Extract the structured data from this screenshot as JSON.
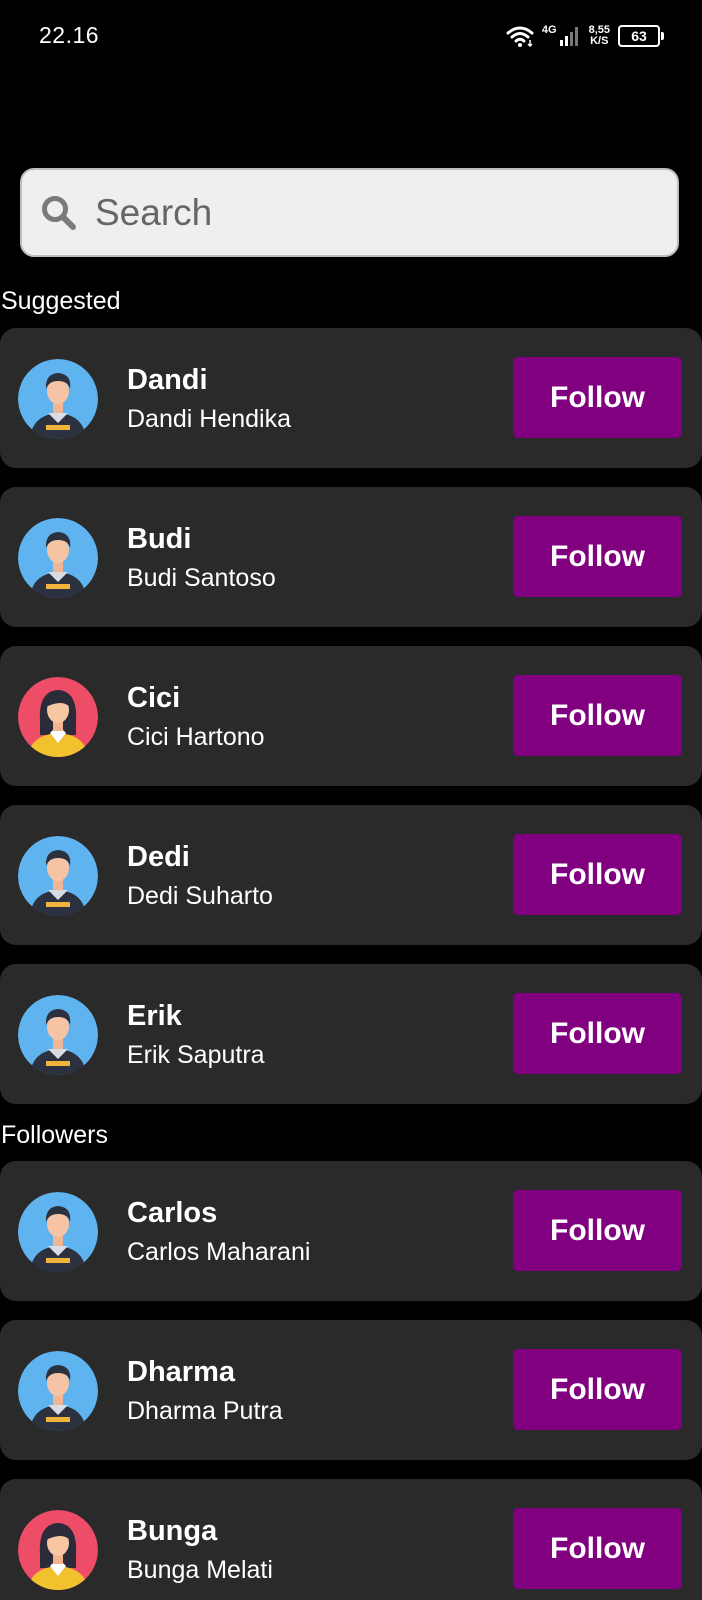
{
  "status_bar": {
    "time": "22.16",
    "network_type": "4G",
    "speed_value": "8,55",
    "speed_unit": "K/S",
    "battery": "63"
  },
  "search": {
    "placeholder": "Search"
  },
  "sections": {
    "suggested": {
      "heading": "Suggested",
      "users": [
        {
          "username": "Dandi",
          "fullname": "Dandi Hendika",
          "button": "Follow",
          "avatar": "male"
        },
        {
          "username": "Budi",
          "fullname": "Budi Santoso",
          "button": "Follow",
          "avatar": "male"
        },
        {
          "username": "Cici",
          "fullname": "Cici Hartono",
          "button": "Follow",
          "avatar": "female"
        },
        {
          "username": "Dedi",
          "fullname": "Dedi Suharto",
          "button": "Follow",
          "avatar": "male"
        },
        {
          "username": "Erik",
          "fullname": "Erik Saputra",
          "button": "Follow",
          "avatar": "male"
        }
      ]
    },
    "followers": {
      "heading": "Followers",
      "users": [
        {
          "username": "Carlos",
          "fullname": "Carlos Maharani",
          "button": "Follow",
          "avatar": "male"
        },
        {
          "username": "Dharma",
          "fullname": "Dharma Putra",
          "button": "Follow",
          "avatar": "male"
        },
        {
          "username": "Bunga",
          "fullname": "Bunga Melati",
          "button": "Follow",
          "avatar": "female"
        }
      ]
    }
  },
  "colors": {
    "background": "#000000",
    "card": "#2a2a2b",
    "follow_button": "#800080",
    "male_avatar_bg": "#5fb4f0",
    "female_avatar_bg": "#ee4d68"
  }
}
